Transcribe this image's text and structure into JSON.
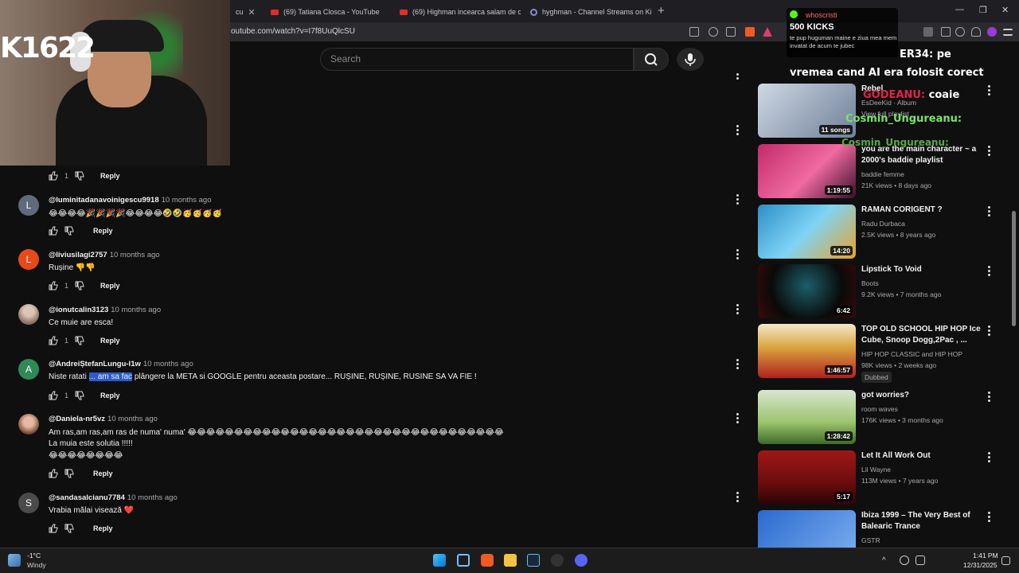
{
  "browser": {
    "tabs": [
      {
        "title": "cu"
      },
      {
        "title": "(69) Tatiana Closca - YouTube"
      },
      {
        "title": "(69) Highman incearca salam de cer"
      },
      {
        "title": "hyghman - Channel Streams on Kick"
      }
    ],
    "url": "outube.com/watch?v=I7f8UuQlcSU"
  },
  "search": {
    "placeholder": "Search"
  },
  "comments": [
    {
      "user": "",
      "time": "",
      "text": "",
      "likes": "1",
      "reply": "Reply"
    },
    {
      "initial": "L",
      "user": "@luminitadanavoinigescu9918",
      "time": "10 months ago",
      "text": "😂😂😂😂🎉🎉🎉🎉😂😂😂😂🤣🤣🥳🥳🥳🥳",
      "likes": "",
      "reply": "Reply"
    },
    {
      "initial": "L",
      "user": "@liviusilagi2757",
      "time": "10 months ago",
      "text": "Rușine 👎👎",
      "likes": "1",
      "reply": "Reply"
    },
    {
      "initial": "",
      "user": "@ionutcalin3123",
      "time": "10 months ago",
      "text": "Ce muie are esca!",
      "likes": "1",
      "reply": "Reply"
    },
    {
      "initial": "A",
      "user": "@AndreiȘtefanLungu-l1w",
      "time": "10 months ago",
      "text_a": "Niste ratati",
      "text_hl": "... am sa fac",
      "text_b": " plângere la META si GOOGLE pentru aceasta postare... RUȘINE, RUȘINE, RUSINE SA VA FIE !",
      "likes": "1",
      "reply": "Reply"
    },
    {
      "initial": "",
      "user": "@Daniela-nr5vz",
      "time": "10 months ago",
      "line1": "Am ras,am ras,am ras de numa' numa' 😂😂😂😂😂😂😂😂😂😂😂😂😂😂😂😂😂😂😂😂😂😂😂😂😂😂😂😂😂😂😂😂😂😂",
      "line2": "La muia este solutia !!!!!",
      "line3": "😂😂😂😂😂😂😂😂",
      "likes": "",
      "reply": "Reply"
    },
    {
      "initial": "S",
      "user": "@sandasalcianu7784",
      "time": "10 months ago",
      "text": "Vrabia mălai visează    ❤️",
      "likes": "",
      "reply": "Reply"
    }
  ],
  "recommendations": [
    {
      "title": "Rebel",
      "channel": "EsDeeKid · Album",
      "meta": "View full playlist",
      "duration": "11 songs"
    },
    {
      "title": "you are the main character ~ a 2000's baddie playlist",
      "channel": "baddie femme",
      "meta": "21K views • 8 days ago",
      "duration": "1:19:55"
    },
    {
      "title": "RAMAN CORIGENT ?",
      "channel": "Radu Durbaca",
      "meta": "2.5K views • 8 years ago",
      "duration": "14:20"
    },
    {
      "title": "Lipstick To Void",
      "channel": "Boots",
      "meta": "9.2K views • 7 months ago",
      "duration": "6:42"
    },
    {
      "title": "TOP OLD SCHOOL HIP HOP Ice Cube, Snoop Dogg,2Pac , ...",
      "channel": "HIP HOP CLASSIC and HIP HOP",
      "meta": "98K views • 2 weeks ago",
      "badge": "Dubbed",
      "duration": "1:46:57"
    },
    {
      "title": "got worries?",
      "channel": "room waves",
      "meta": "176K views • 3 months ago",
      "duration": "1:28:42"
    },
    {
      "title": "Let It All Work Out",
      "channel": "Lil Wayne",
      "meta": "113M views • 7 years ago",
      "duration": "5:17"
    },
    {
      "title": "Ibiza 1999 – The Very Best of Balearic Trance",
      "channel": "GSTR",
      "meta": "",
      "duration": ""
    }
  ],
  "stream": {
    "cam_tag": "K1622",
    "kicks_user": "whoscristi",
    "kicks_amount": "500 KICKS",
    "kicks_msg": "te pup huguman maine e ziua mea mem invatat de acum te jubec",
    "chat_1": "ER34: pe",
    "chat_2": "vremea cand AI era folosit corect",
    "chat_3_user": "GODEANU:",
    "chat_3_msg": "coaie",
    "chat_4_user": "Cosmin_Ungureanu:",
    "chat_5_user": "Cosmin_Ungureanu:"
  },
  "taskbar": {
    "weather_temp": "-1°C",
    "weather_desc": "Windy",
    "time": "1:41 PM",
    "date": "12/31/2025"
  }
}
